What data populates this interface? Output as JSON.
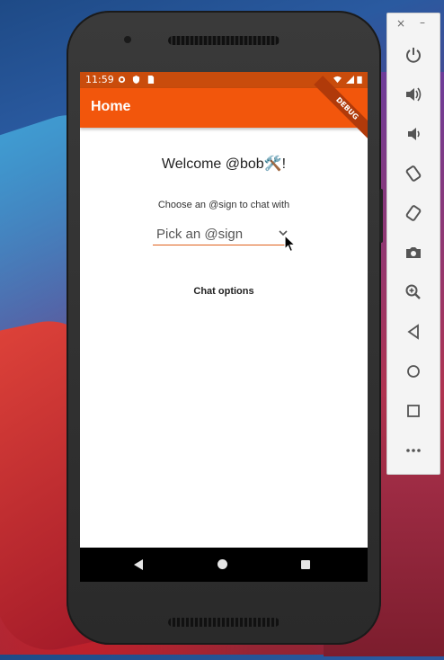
{
  "status_bar": {
    "time": "11:59"
  },
  "app_bar": {
    "title": "Home",
    "debug_banner": "DEBUG"
  },
  "content": {
    "welcome": "Welcome @bob🛠️!",
    "choose_prompt": "Choose an @sign to chat with",
    "dropdown_hint": "Pick an @sign",
    "chat_options": "Chat options"
  },
  "emulator_toolbar": {
    "close": "×",
    "minimize": "–",
    "buttons": [
      "power-icon",
      "volume-up-icon",
      "volume-down-icon",
      "rotate-left-icon",
      "rotate-right-icon",
      "camera-icon",
      "zoom-icon",
      "back-icon",
      "home-icon",
      "overview-icon",
      "more-icon"
    ]
  },
  "colors": {
    "app_bar": "#f2560c",
    "status_bar": "#c94c0c",
    "underline": "#e0601c"
  }
}
